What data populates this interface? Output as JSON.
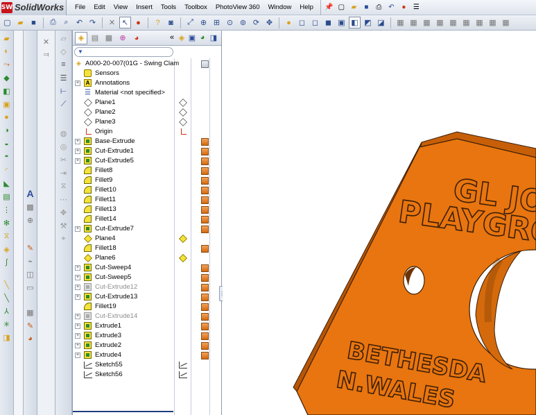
{
  "app": {
    "logo_mark": "SW",
    "name": "SolidWorks"
  },
  "menu": [
    "File",
    "Edit",
    "View",
    "Insert",
    "Tools",
    "Toolbox",
    "PhotoView 360",
    "Window",
    "Help"
  ],
  "feature_tree": {
    "root_label": "A000-20-007(01G - Swing Clam",
    "tab_collapse": "«",
    "items": [
      {
        "label": "Sensors",
        "icon": "sensor-icon",
        "expander": false,
        "c1": "",
        "c2": ""
      },
      {
        "label": "Annotations",
        "icon": "annotation-icon",
        "expander": true,
        "c1": "",
        "c2": ""
      },
      {
        "label": "Material <not specified>",
        "icon": "material-icon",
        "expander": false,
        "c1": "",
        "c2": ""
      },
      {
        "label": "Plane1",
        "icon": "plane-icon",
        "expander": false,
        "c1": "plane",
        "c2": ""
      },
      {
        "label": "Plane2",
        "icon": "plane-icon",
        "expander": false,
        "c1": "plane",
        "c2": ""
      },
      {
        "label": "Plane3",
        "icon": "plane-icon",
        "expander": false,
        "c1": "plane",
        "c2": ""
      },
      {
        "label": "Origin",
        "icon": "origin-icon",
        "expander": false,
        "c1": "origin",
        "c2": ""
      },
      {
        "label": "Base-Extrude",
        "icon": "extrude-icon",
        "expander": true,
        "c1": "",
        "c2": "orange"
      },
      {
        "label": "Cut-Extrude1",
        "icon": "extrude-icon",
        "expander": true,
        "c1": "",
        "c2": "orange"
      },
      {
        "label": "Cut-Extrude5",
        "icon": "extrude-icon",
        "expander": true,
        "c1": "",
        "c2": "orange"
      },
      {
        "label": "Fillet8",
        "icon": "fillet-icon",
        "expander": false,
        "c1": "",
        "c2": "orange"
      },
      {
        "label": "Fillet9",
        "icon": "fillet-icon",
        "expander": false,
        "c1": "",
        "c2": "orange"
      },
      {
        "label": "Fillet10",
        "icon": "fillet-icon",
        "expander": false,
        "c1": "",
        "c2": "orange"
      },
      {
        "label": "Fillet11",
        "icon": "fillet-icon",
        "expander": false,
        "c1": "",
        "c2": "orange"
      },
      {
        "label": "Fillet13",
        "icon": "fillet-icon",
        "expander": false,
        "c1": "",
        "c2": "orange"
      },
      {
        "label": "Fillet14",
        "icon": "fillet-icon",
        "expander": false,
        "c1": "",
        "c2": "orange"
      },
      {
        "label": "Cut-Extrude7",
        "icon": "extrude-icon",
        "expander": true,
        "c1": "",
        "c2": "orange"
      },
      {
        "label": "Plane4",
        "icon": "plane-yellow-icon",
        "expander": false,
        "c1": "plane-yellow",
        "c2": ""
      },
      {
        "label": "Fillet18",
        "icon": "fillet-icon",
        "expander": false,
        "c1": "",
        "c2": "orange"
      },
      {
        "label": "Plane6",
        "icon": "plane-yellow-icon",
        "expander": false,
        "c1": "plane-yellow",
        "c2": ""
      },
      {
        "label": "Cut-Sweep4",
        "icon": "sweep-icon",
        "expander": true,
        "c1": "",
        "c2": "orange"
      },
      {
        "label": "Cut-Sweep5",
        "icon": "sweep-icon",
        "expander": true,
        "c1": "",
        "c2": "orange"
      },
      {
        "label": "Cut-Extrude12",
        "icon": "extrude-suppressed-icon",
        "expander": true,
        "c1": "",
        "c2": "orange",
        "dim": true
      },
      {
        "label": "Cut-Extrude13",
        "icon": "extrude-icon",
        "expander": true,
        "c1": "",
        "c2": "orange"
      },
      {
        "label": "Fillet19",
        "icon": "fillet-icon",
        "expander": false,
        "c1": "",
        "c2": "orange"
      },
      {
        "label": "Cut-Extrude14",
        "icon": "extrude-suppressed-icon",
        "expander": true,
        "c1": "",
        "c2": "orange",
        "dim": true
      },
      {
        "label": "Extrude1",
        "icon": "extrude-icon",
        "expander": true,
        "c1": "",
        "c2": "orange"
      },
      {
        "label": "Extrude3",
        "icon": "extrude-icon",
        "expander": true,
        "c1": "",
        "c2": "orange"
      },
      {
        "label": "Extrude2",
        "icon": "extrude-icon",
        "expander": true,
        "c1": "",
        "c2": "orange"
      },
      {
        "label": "Extrude4",
        "icon": "extrude-icon",
        "expander": true,
        "c1": "",
        "c2": "orange"
      },
      {
        "label": "Sketch55",
        "icon": "sketch-icon",
        "expander": false,
        "c1": "sketch",
        "c2": ""
      },
      {
        "label": "Sketch56",
        "icon": "sketch-icon",
        "expander": false,
        "c1": "sketch",
        "c2": ""
      }
    ]
  },
  "model": {
    "engraving_line1": "GL JO",
    "engraving_line2": "PLAYGRO",
    "engraving_line3": "BETHESDA",
    "engraving_line4": "N.WALES",
    "body_color": "#e8750f",
    "edge_color": "#3b1e08"
  }
}
